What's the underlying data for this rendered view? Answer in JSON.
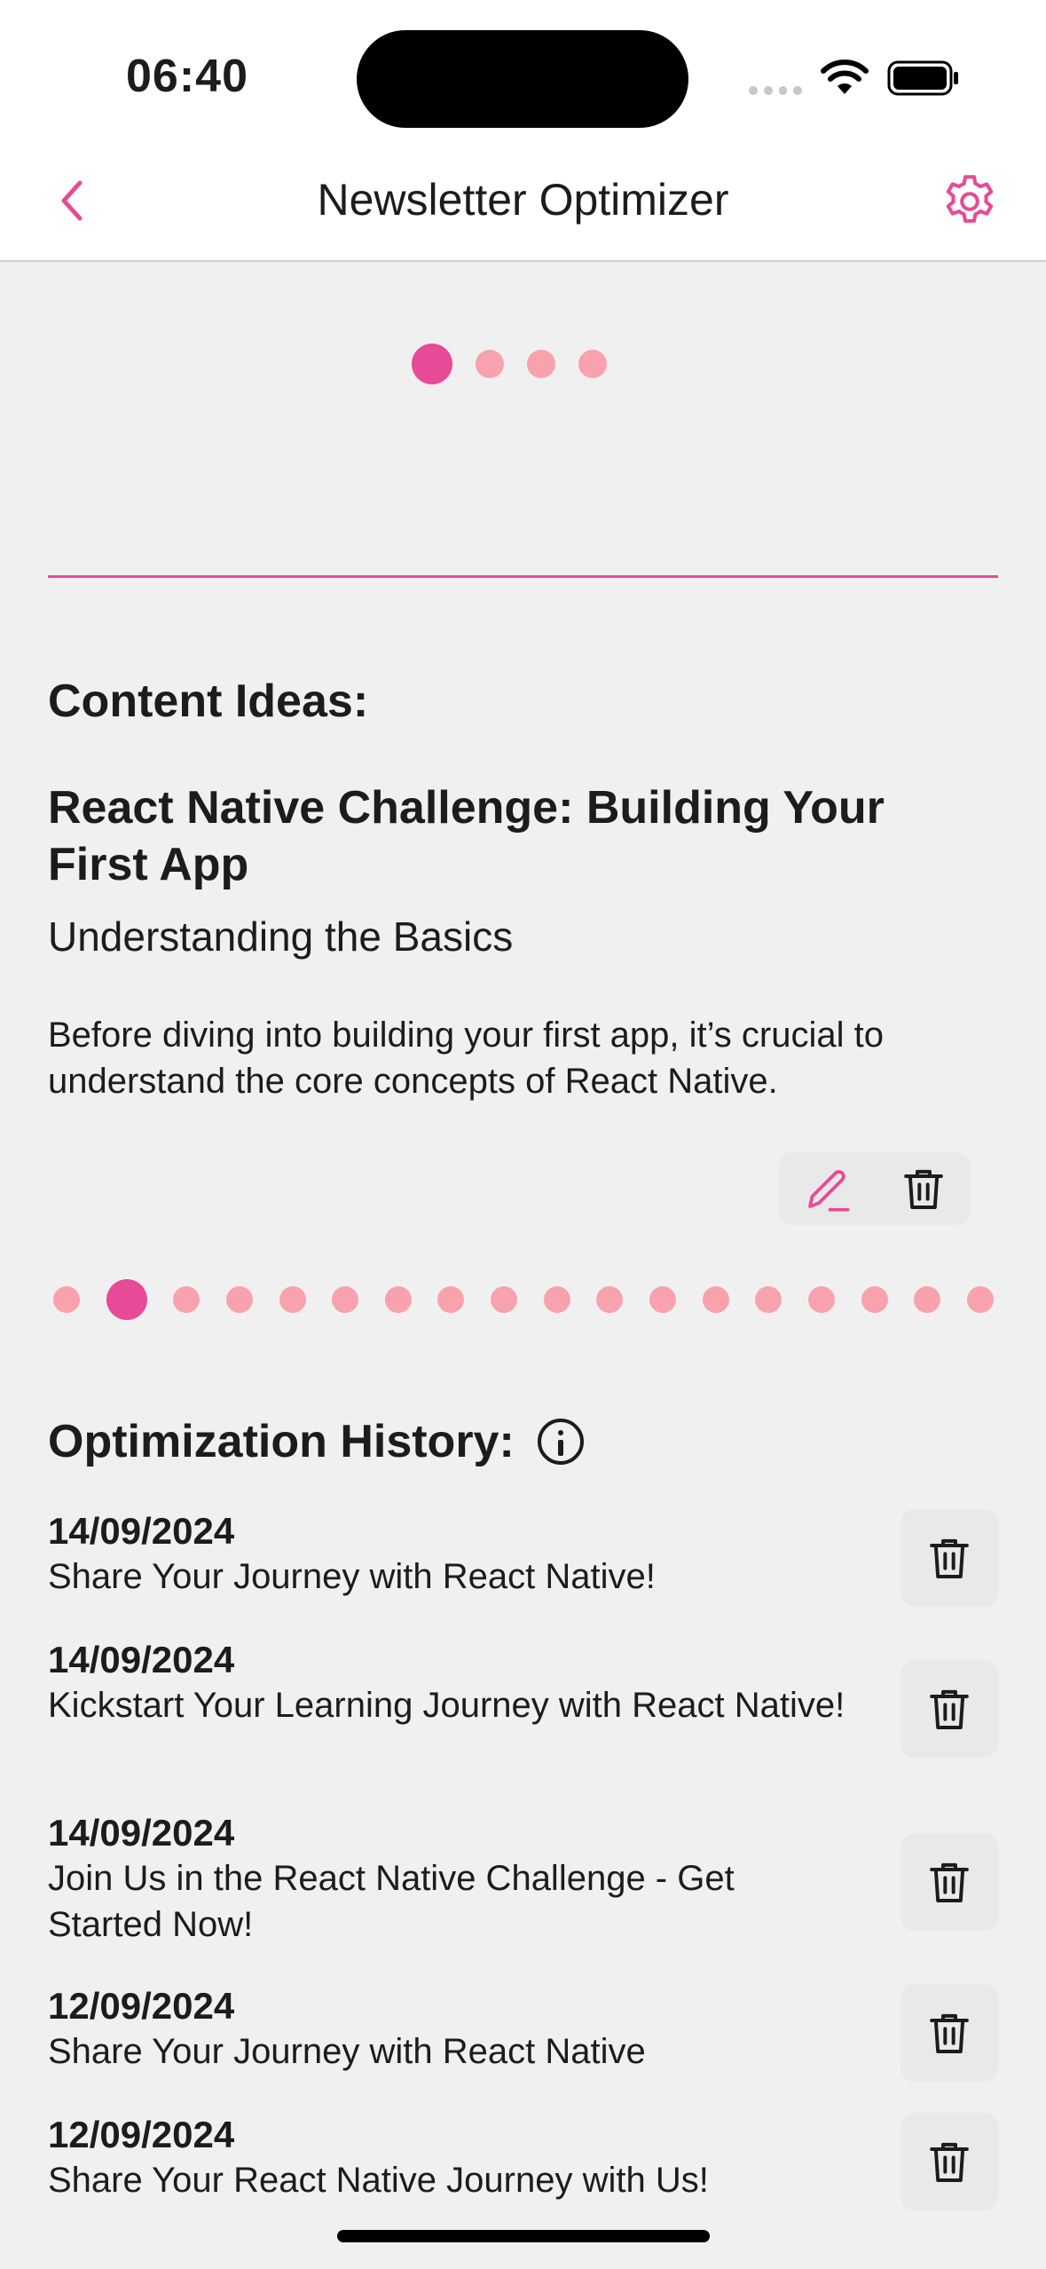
{
  "status_bar": {
    "time": "06:40"
  },
  "nav": {
    "title": "Newsletter Optimizer"
  },
  "top_pager": {
    "count": 4,
    "active_index": 0
  },
  "content": {
    "section_label": "Content Ideas:",
    "idea_title": "React Native Challenge: Building Your First App",
    "idea_subtitle": "Understanding the Basics",
    "idea_description": "Before diving into building your first app, it’s crucial to understand the core concepts of React Native."
  },
  "ideas_pager": {
    "count": 18,
    "active_index": 1
  },
  "history": {
    "label": "Optimization History:",
    "items": [
      {
        "date": "14/09/2024",
        "text": "Share Your Journey with React Native!"
      },
      {
        "date": "14/09/2024",
        "text": "Kickstart Your Learning Journey with React Native!"
      },
      {
        "date": "14/09/2024",
        "text": "Join Us in the React Native Challenge - Get Started Now!"
      },
      {
        "date": "12/09/2024",
        "text": "Share Your Journey with React Native"
      },
      {
        "date": "12/09/2024",
        "text": "Share Your React Native Journey with Us!"
      }
    ]
  },
  "colors": {
    "accent": "#e74a97",
    "dot_inactive": "#f7a2ad"
  }
}
